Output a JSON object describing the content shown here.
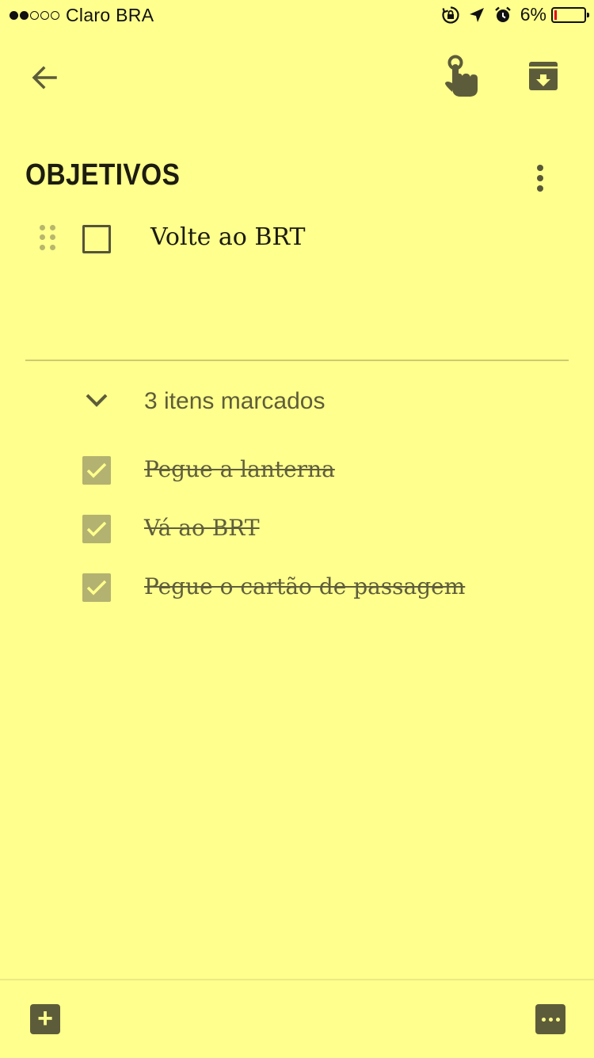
{
  "status_bar": {
    "signal_bars_filled": 2,
    "signal_bars_total": 5,
    "carrier": "Claro BRA",
    "battery_percent": "6%",
    "icons": [
      "rotation-lock-icon",
      "location-arrow-icon",
      "alarm-icon",
      "battery-icon"
    ]
  },
  "toolbar": {
    "icons": [
      "back-arrow-icon",
      "reminder-finger-icon",
      "archive-icon"
    ]
  },
  "note": {
    "title": "OBJETIVOS",
    "unchecked_items": [
      {
        "text": "Volte ao BRT",
        "checked": false
      }
    ],
    "checked_summary": "3 itens marcados",
    "checked_items": [
      {
        "text": "Pegue a lanterna",
        "checked": true
      },
      {
        "text": "Vá ao BRT",
        "checked": true
      },
      {
        "text": "Pegue o cartão de passagem",
        "checked": true
      }
    ]
  },
  "bottom_bar": {
    "icons": [
      "add-icon",
      "more-icon"
    ]
  },
  "colors": {
    "background": "#FFFF8D",
    "icon": "#5d5c3a",
    "checked_box": "#b3b270",
    "checked_text": "#5f5e3d"
  }
}
